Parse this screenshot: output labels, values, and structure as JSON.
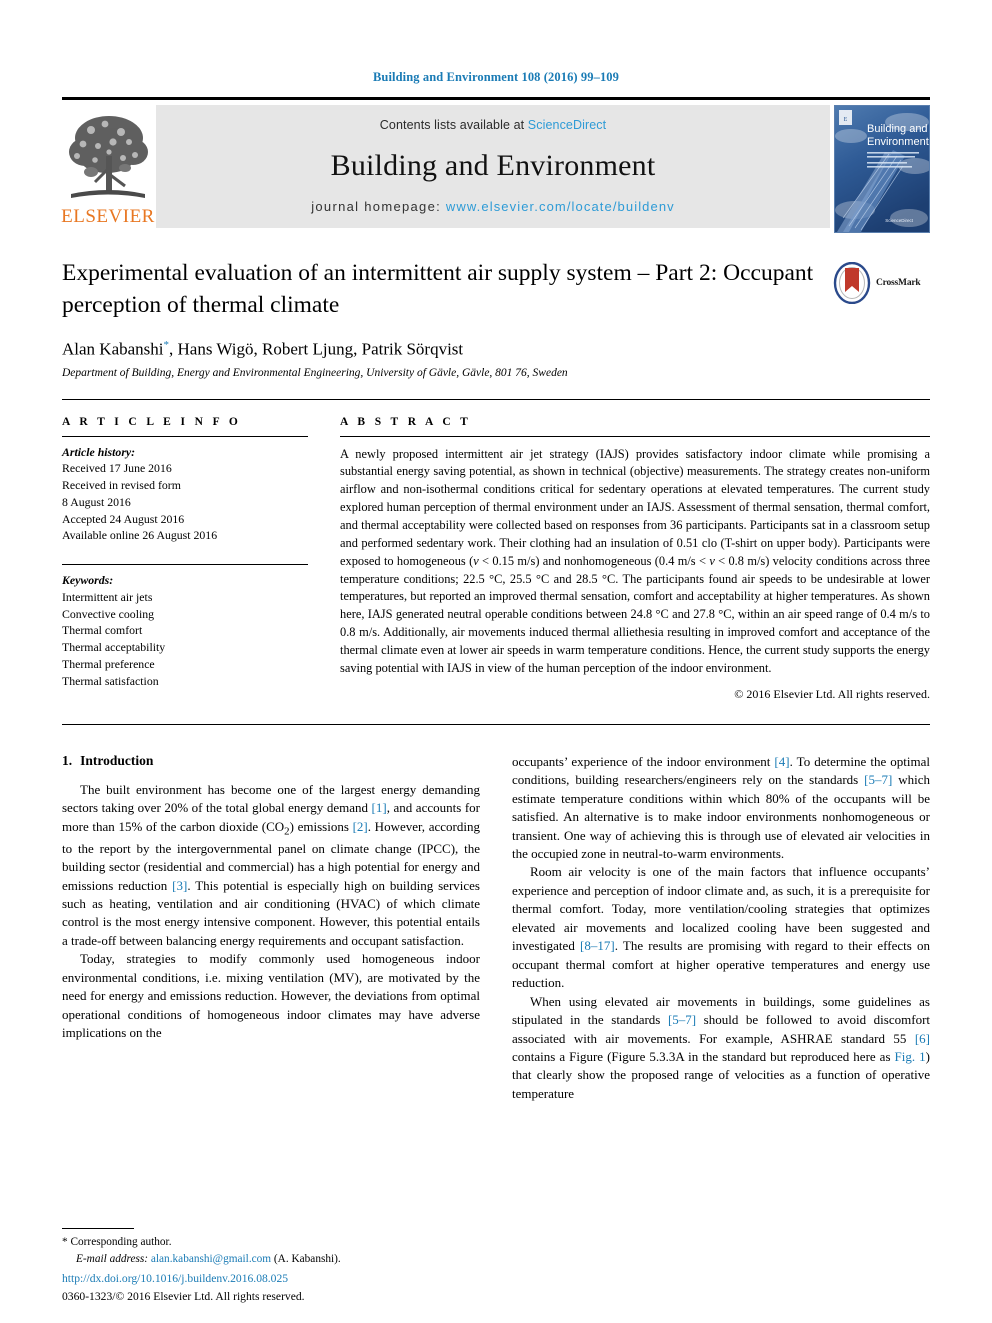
{
  "running_head": "Building and Environment 108 (2016) 99–109",
  "masthead": {
    "publisher_name": "ELSEVIER",
    "contents_prefix": "Contents lists available at ",
    "contents_link": "ScienceDirect",
    "journal_title": "Building and Environment",
    "homepage_prefix": "journal homepage: ",
    "homepage_url": "www.elsevier.com/locate/buildenv",
    "cover_title_line1": "Building and",
    "cover_title_line2": "Environment",
    "link_color": "#2e9bd6"
  },
  "article": {
    "title": "Experimental evaluation of an intermittent air supply system – Part 2: Occupant perception of thermal climate",
    "authors": "Alan Kabanshi",
    "authors_rest": ", Hans Wigö, Robert Ljung, Patrik Sörqvist",
    "corresponding_marker": "*",
    "affiliation": "Department of Building, Energy and Environmental Engineering, University of Gävle, Gävle, 801 76, Sweden",
    "crossmark_label": "CrossMark"
  },
  "info": {
    "heading": "A R T I C L E  I N F O",
    "history_label": "Article history:",
    "history": [
      "Received 17 June 2016",
      "Received in revised form",
      "8 August 2016",
      "Accepted 24 August 2016",
      "Available online 26 August 2016"
    ],
    "keywords_label": "Keywords:",
    "keywords": [
      "Intermittent air jets",
      "Convective cooling",
      "Thermal comfort",
      "Thermal acceptability",
      "Thermal preference",
      "Thermal satisfaction"
    ]
  },
  "abstract": {
    "heading": "A B S T R A C T",
    "text_part1": "A newly proposed intermittent air jet strategy (IAJS) provides satisfactory indoor climate while promising a substantial energy saving potential, as shown in technical (objective) measurements. The strategy creates non-uniform airflow and non-isothermal conditions critical for sedentary operations at elevated temperatures. The current study explored human perception of thermal environment under an IAJS. Assessment of thermal sensation, thermal comfort, and thermal acceptability were collected based on responses from 36 participants. Participants sat in a classroom setup and performed sedentary work. Their clothing had an insulation of 0.51 clo (T-shirt on upper body). Participants were exposed to homogeneous (",
    "ital1": "v",
    "text_part2": " < 0.15 m/s) and nonhomogeneous (0.4 m/s < ",
    "ital2": "v",
    "text_part3": " < 0.8 m/s) velocity conditions across three temperature conditions; 22.5 °C, 25.5 °C and 28.5 °C. The participants found air speeds to be undesirable at lower temperatures, but reported an improved thermal sensation, comfort and acceptability at higher temperatures. As shown here, IAJS generated neutral operable conditions between 24.8 °C and 27.8 °C, within an air speed range of 0.4 m/s to 0.8 m/s. Additionally, air movements induced thermal alliethesia resulting in improved comfort and acceptance of the thermal climate even at lower air speeds in warm temperature conditions. Hence, the current study supports the energy saving potential with IAJS in view of the human perception of the indoor environment.",
    "copyright": "© 2016 Elsevier Ltd. All rights reserved."
  },
  "body": {
    "section_number": "1.",
    "section_title": "Introduction",
    "left_p1_a": "The built environment has become one of the largest energy demanding sectors taking over 20% of the total global energy demand ",
    "left_p1_r1": "[1]",
    "left_p1_b": ", and accounts for more than 15% of the carbon dioxide (CO",
    "left_p1_sub": "2",
    "left_p1_c": ") emissions ",
    "left_p1_r2": "[2]",
    "left_p1_d": ". However, according to the report by the intergovernmental panel on climate change (IPCC), the building sector (residential and commercial) has a high potential for energy and emissions reduction ",
    "left_p1_r3": "[3]",
    "left_p1_e": ". This potential is especially high on building services such as heating, ventilation and air conditioning (HVAC) of which climate control is the most energy intensive component. However, this potential entails a trade-off between balancing energy requirements and occupant satisfaction.",
    "left_p2": "Today, strategies to modify commonly used homogeneous indoor environmental conditions, i.e. mixing ventilation (MV), are motivated by the need for energy and emissions reduction. However, the deviations from optimal operational conditions of homogeneous indoor climates may have adverse implications on the",
    "right_p1_a": "occupants’ experience of the indoor environment ",
    "right_p1_r1": "[4]",
    "right_p1_b": ". To determine the optimal conditions, building researchers/engineers rely on the standards ",
    "right_p1_r2": "[5–7]",
    "right_p1_c": " which estimate temperature conditions within which 80% of the occupants will be satisfied. An alternative is to make indoor environments nonhomogeneous or transient. One way of achieving this is through use of elevated air velocities in the occupied zone in neutral-to-warm environments.",
    "right_p2_a": "Room air velocity is one of the main factors that influence occupants’ experience and perception of indoor climate and, as such, it is a prerequisite for thermal comfort. Today, more ventilation/cooling strategies that optimizes elevated air movements and localized cooling have been suggested and investigated ",
    "right_p2_r1": "[8–17]",
    "right_p2_b": ". The results are promising with regard to their effects on occupant thermal comfort at higher operative temperatures and energy use reduction.",
    "right_p3_a": "When using elevated air movements in buildings, some guidelines as stipulated in the standards ",
    "right_p3_r1": "[5–7]",
    "right_p3_b": " should be followed to avoid discomfort associated with air movements. For example, ASHRAE standard 55 ",
    "right_p3_r2": "[6]",
    "right_p3_c": " contains a Figure (Figure 5.3.3A in the standard but reproduced here as ",
    "right_p3_r3": "Fig. 1",
    "right_p3_d": ") that clearly show the proposed range of velocities as a function of operative temperature"
  },
  "footer": {
    "corresponding_marker": "*",
    "corresponding_label": " Corresponding author.",
    "email_label": "E-mail address:",
    "email": "alan.kabanshi@gmail.com",
    "email_suffix": " (A. Kabanshi).",
    "doi": "http://dx.doi.org/10.1016/j.buildenv.2016.08.025",
    "issn_line": "0360-1323/© 2016 Elsevier Ltd. All rights reserved."
  }
}
